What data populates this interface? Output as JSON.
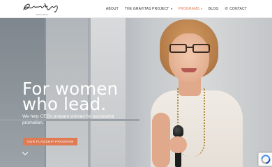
{
  "header": {
    "logo_alt": "Gravitas",
    "logo_sub": "PROJECT",
    "nav": [
      {
        "label": "ABOUT",
        "has_caret": false,
        "active": false
      },
      {
        "label": "THE GRAVITAS PROJECT",
        "has_caret": true,
        "active": false
      },
      {
        "label": "PROGRAMS",
        "has_caret": true,
        "active": true
      },
      {
        "label": "BLOG",
        "has_caret": false,
        "active": false
      },
      {
        "label": "CONTACT",
        "has_caret": false,
        "active": false,
        "icon": "phone-icon"
      }
    ]
  },
  "hero": {
    "title": "For women who lead.",
    "subtitle": "We help CEOs prepare women for successful promotion.",
    "cta_label": "OUR FLAGSHIP PROGRAM",
    "scroll_icon": "chevron-down-icon"
  },
  "colors": {
    "accent": "#e07a52",
    "nav_text": "#333333",
    "hero_text": "#ffffff"
  },
  "widgets": {
    "recaptcha_icon": "recaptcha-icon"
  }
}
